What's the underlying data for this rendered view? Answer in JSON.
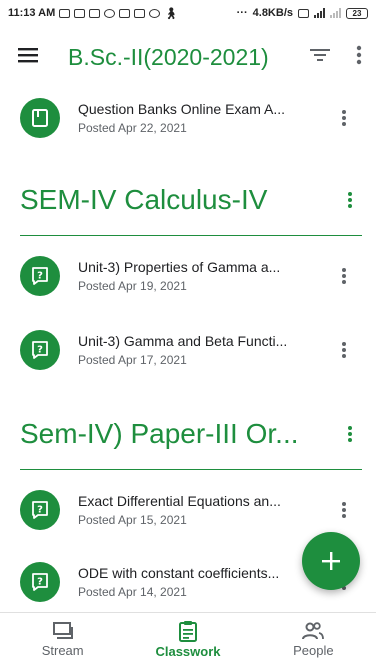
{
  "status_bar": {
    "time": "11:13 AM",
    "more": "···",
    "speed": "4.8KB/s",
    "battery": "23"
  },
  "app_bar": {
    "title": "B.Sc.-II(2020-2021)",
    "icons": [
      "menu-icon",
      "filter-icon",
      "more-vert-icon"
    ]
  },
  "items": [
    {
      "title": "Question Banks Online Exam A...",
      "date": "Posted Apr 22, 2021",
      "icon": "material-icon"
    },
    {
      "title": "Unit-3) Properties of Gamma a...",
      "date": "Posted Apr 19, 2021",
      "icon": "question-icon"
    },
    {
      "title": "Unit-3) Gamma and Beta Functi...",
      "date": "Posted Apr 17, 2021",
      "icon": "question-icon"
    },
    {
      "title": "Exact Differential Equations an...",
      "date": "Posted Apr 15, 2021",
      "icon": "question-icon"
    },
    {
      "title": "ODE with constant coefficients...",
      "date": "Posted Apr 14, 2021",
      "icon": "question-icon"
    }
  ],
  "topics": [
    {
      "title": "SEM-IV Calculus-IV"
    },
    {
      "title": "Sem-IV) Paper-III Or..."
    }
  ],
  "fab": {
    "icon": "add-icon"
  },
  "bottom_nav": {
    "items": [
      {
        "label": "Stream",
        "icon": "stream-icon"
      },
      {
        "label": "Classwork",
        "icon": "classwork-icon",
        "active": true
      },
      {
        "label": "People",
        "icon": "people-icon"
      }
    ]
  },
  "colors": {
    "accent": "#1e8e3e",
    "text_primary": "#202124",
    "text_secondary": "#5f6368"
  }
}
